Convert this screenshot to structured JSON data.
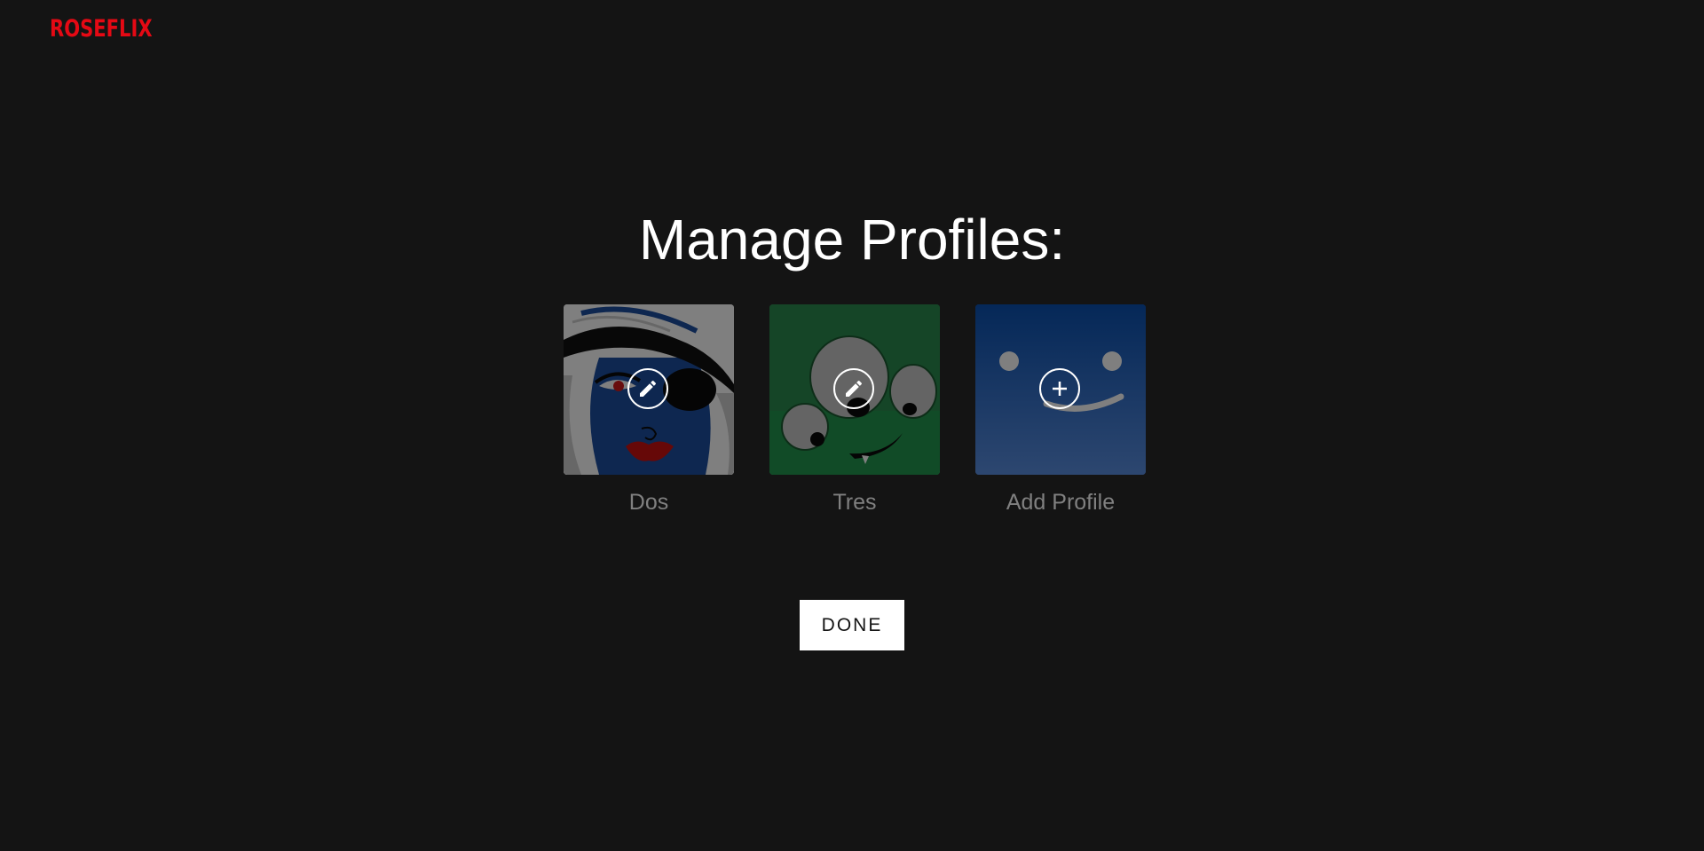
{
  "app": {
    "logo_text": "ROSEFLIX",
    "brand_color": "#e50914",
    "background_color": "#141414"
  },
  "main": {
    "title": "Manage Profiles:",
    "profiles": [
      {
        "name": "Dos",
        "action_icon": "pencil-icon",
        "avatar_color": "#1d4fa0"
      },
      {
        "name": "Tres",
        "action_icon": "pencil-icon",
        "avatar_color": "#2a8a4e"
      },
      {
        "name": "Add Profile",
        "action_icon": "plus-icon",
        "avatar_color": "#0a4ea8"
      }
    ],
    "done_label": "DONE"
  }
}
